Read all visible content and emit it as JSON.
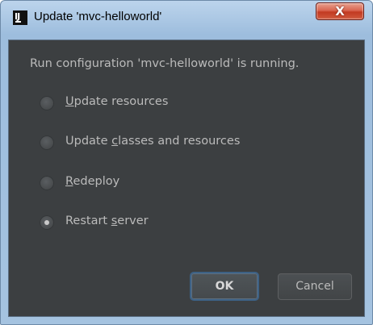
{
  "window": {
    "title": "Update 'mvc-helloworld'",
    "app_icon_text": "IJ",
    "close_glyph": "X"
  },
  "dialog": {
    "message": "Run configuration 'mvc-helloworld' is running.",
    "options": [
      {
        "mnemonic_before": "",
        "mnemonic": "U",
        "after": "pdate resources",
        "selected": false
      },
      {
        "mnemonic_before": "Update ",
        "mnemonic": "c",
        "after": "lasses and resources",
        "selected": false
      },
      {
        "mnemonic_before": "",
        "mnemonic": "R",
        "after": "edeploy",
        "selected": false
      },
      {
        "mnemonic_before": "Restart ",
        "mnemonic": "s",
        "after": "erver",
        "selected": true
      }
    ],
    "ok_label": "OK",
    "cancel_label": "Cancel"
  },
  "colors": {
    "dialog_background": "#3c3f41",
    "text": "#bbbbbb",
    "default_button_border": "#3d6185",
    "titlebar": "#a9c6e3",
    "close_button": "#c23a22"
  },
  "icons": {
    "app": "intellij-idea-icon",
    "close": "close-icon"
  }
}
